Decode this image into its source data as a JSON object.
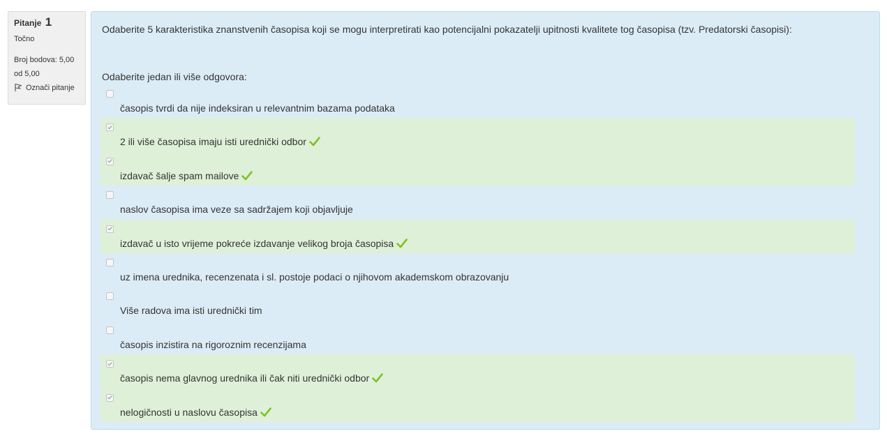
{
  "info": {
    "question_label": "Pitanje",
    "question_number": "1",
    "state": "Točno",
    "grade": "Broj bodova: 5,00 od 5,00",
    "flag_label": "Označi pitanje"
  },
  "question": {
    "text": "Odaberite 5 karakteristika znanstvenih časopisa koji se mogu interpretirati kao potencijalni pokazatelji upitnosti kvalitete tog časopisa (tzv. Predatorski časopisi):",
    "prompt": "Odaberite jedan ili više odgovora:"
  },
  "answers": [
    {
      "label": "časopis tvrdi da nije indeksiran u relevantnim bazama podataka",
      "checked": false,
      "correct": false
    },
    {
      "label": "2 ili više časopisa imaju isti urednički odbor",
      "checked": true,
      "correct": true
    },
    {
      "label": "izdavač šalje spam mailove",
      "checked": true,
      "correct": true
    },
    {
      "label": "naslov časopisa ima veze sa sadržajem koji objavljuje",
      "checked": false,
      "correct": false
    },
    {
      "label": "izdavač u isto vrijeme pokreće izdavanje velikog broja časopisa",
      "checked": true,
      "correct": true
    },
    {
      "label": "uz imena urednika, recenzenata i sl. postoje podaci o njihovom akademskom obrazovanju",
      "checked": false,
      "correct": false
    },
    {
      "label": "Više radova ima isti urednički tim",
      "checked": false,
      "correct": false
    },
    {
      "label": "časopis inzistira na rigoroznim recenzijama",
      "checked": false,
      "correct": false
    },
    {
      "label": "časopis nema glavnog urednika ili čak niti urednički odbor",
      "checked": true,
      "correct": true
    },
    {
      "label": "nelogičnosti u naslovu časopisa",
      "checked": true,
      "correct": true
    }
  ],
  "colors": {
    "correct_bg": "#dff0d8",
    "content_bg": "#dcecf6",
    "tick": "#7cc224"
  }
}
